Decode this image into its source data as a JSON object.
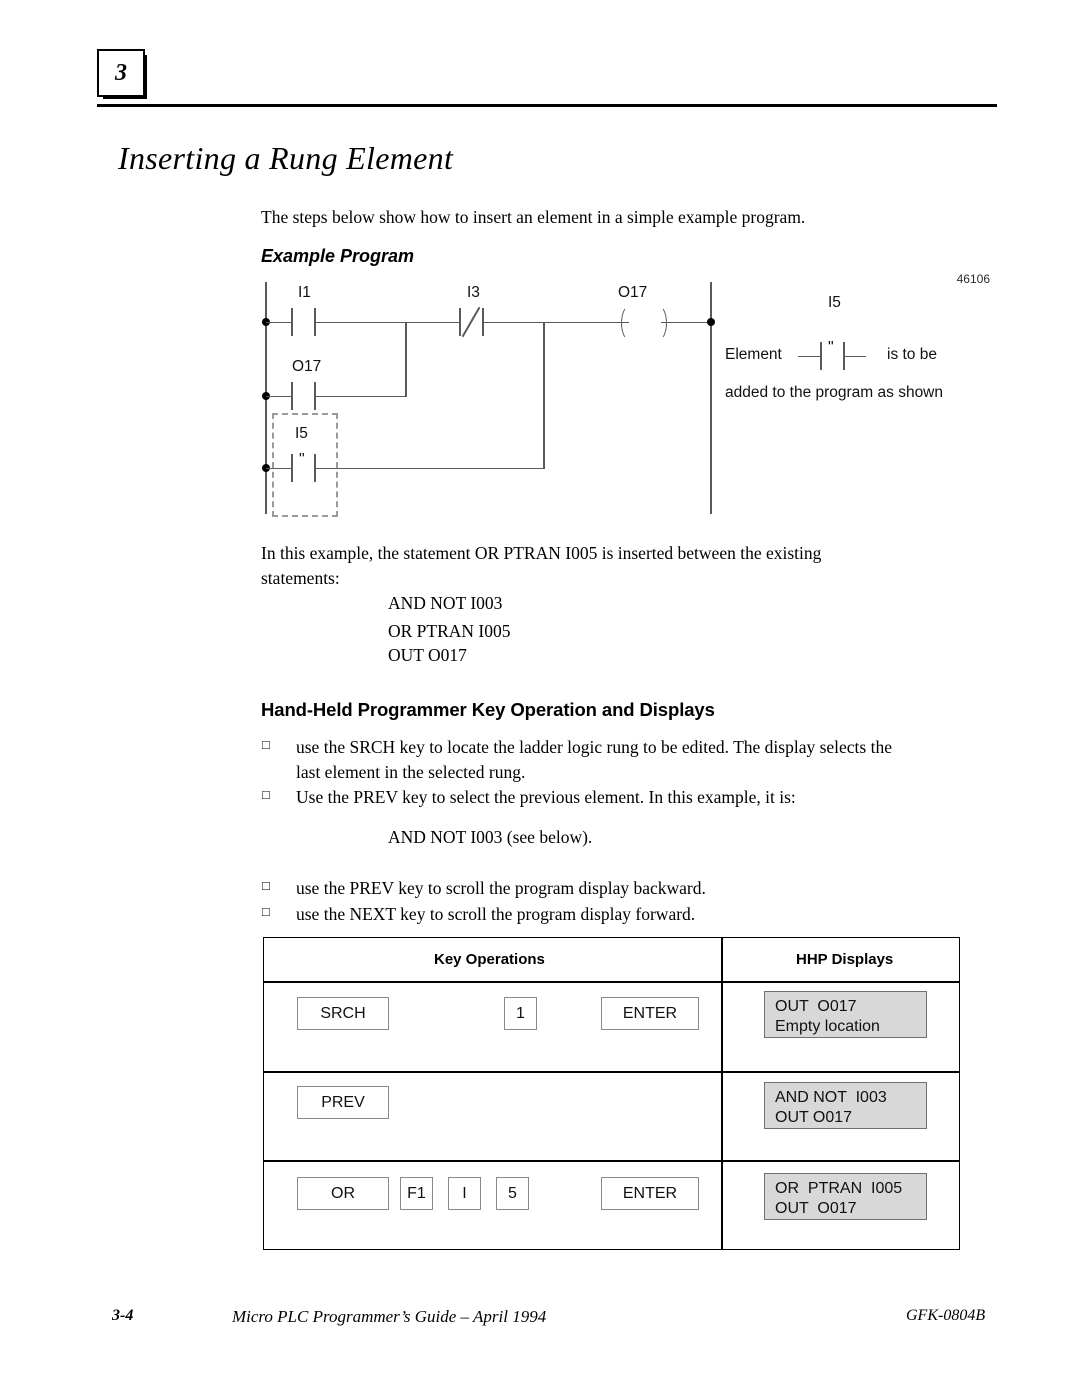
{
  "header": {
    "chapter_number": "3"
  },
  "title": "Inserting a Rung Element",
  "intro": "The steps below show how to insert an element in a simple example program.",
  "sections": {
    "example_program_heading": "Example Program",
    "hhp_heading": "Hand-Held Programmer Key Operation and Displays"
  },
  "figure": {
    "id_label": "46106",
    "labels": {
      "i1": "I1",
      "i3": "I3",
      "o17_coil": "O17",
      "o17_contact": "O17",
      "i5": "I5"
    },
    "element_quote": "\"",
    "annotation": {
      "i5_label": "I5",
      "prefix": "Element",
      "quote": "\"",
      "suffix": "is to be",
      "line2": "added to the program as shown"
    }
  },
  "body": {
    "explanation_line1": "In this example, the statement OR PTRAN I005 is inserted between the existing",
    "explanation_line2": "statements:",
    "statements": [
      "AND NOT I003",
      "OR PTRAN I005",
      "OUT O017"
    ]
  },
  "bullets": [
    {
      "mark": "□",
      "line1": "use the SRCH key to locate the ladder logic rung to be edited. The display selects the",
      "line2": "last element in the selected rung."
    },
    {
      "mark": "□",
      "line1": "Use the PREV key to select the previous element. In this example, it is:",
      "line2": ""
    },
    {
      "mark": "□",
      "line1": "use the PREV key to scroll the program display backward.",
      "line2": ""
    },
    {
      "mark": "□",
      "line1": "use the NEXT key to scroll the program display forward.",
      "line2": ""
    }
  ],
  "inline_statement": "AND NOT I003 (see below).",
  "table": {
    "headers": {
      "key_operations": "Key Operations",
      "hhp_displays": "HHP Displays"
    },
    "rows": [
      {
        "keys": [
          "SRCH",
          "1",
          "ENTER"
        ],
        "display_line1": "OUT  O017",
        "display_line2": "Empty location"
      },
      {
        "keys": [
          "PREV"
        ],
        "display_line1": "AND NOT  I003",
        "display_line2": "OUT O017"
      },
      {
        "keys": [
          "OR",
          "F1",
          "I",
          "5",
          "ENTER"
        ],
        "display_line1": "OR  PTRAN  I005",
        "display_line2": "OUT  O017"
      }
    ]
  },
  "footer": {
    "page_number": "3-4",
    "document_title": "Micro PLC Programmer’s Guide – April 1994",
    "doc_code": "GFK-0804B"
  }
}
